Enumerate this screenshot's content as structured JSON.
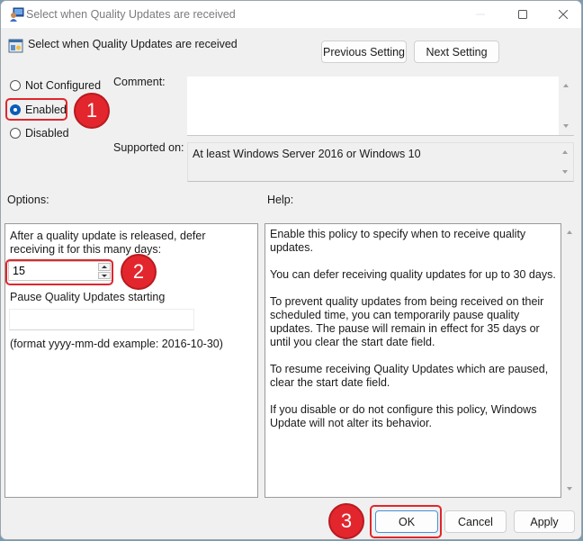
{
  "window": {
    "title": "Select when Quality Updates are received",
    "title_icon": "policy-app-icon",
    "controls": [
      "minimize",
      "maximize",
      "close"
    ]
  },
  "header": {
    "icon": "policy-setting-icon",
    "title": "Select when Quality Updates are received",
    "previous_label": "Previous Setting",
    "next_label": "Next Setting"
  },
  "state": {
    "options": [
      {
        "label": "Not Configured",
        "checked": false
      },
      {
        "label": "Enabled",
        "checked": true
      },
      {
        "label": "Disabled",
        "checked": false
      }
    ]
  },
  "comment": {
    "label": "Comment:",
    "value": ""
  },
  "supported": {
    "label": "Supported on:",
    "value": "At least Windows Server 2016 or Windows 10"
  },
  "options_section": {
    "label": "Options:",
    "defer_description": "After a quality update is released, defer receiving it for this many days:",
    "defer_days_value": "15",
    "pause_label": "Pause Quality Updates starting",
    "pause_value": "",
    "format_hint": "(format yyyy-mm-dd example: 2016-10-30)"
  },
  "help_section": {
    "label": "Help:",
    "paragraphs": [
      "Enable this policy to specify when to receive quality updates.",
      "You can defer receiving quality updates for up to 30 days.",
      "To prevent quality updates from being received on their scheduled time, you can temporarily pause quality updates. The pause will remain in effect for 35 days or until you clear the start date field.",
      "To resume receiving Quality Updates which are paused, clear the start date field.",
      "If you disable or do not configure this policy, Windows Update will not alter its behavior."
    ]
  },
  "footer": {
    "ok_label": "OK",
    "cancel_label": "Cancel",
    "apply_label": "Apply"
  },
  "annotations": [
    {
      "number": "1",
      "target": "Enabled"
    },
    {
      "number": "2",
      "target": "defer-days-spinner"
    },
    {
      "number": "3",
      "target": "OK"
    }
  ],
  "colors": {
    "annotation_red": "#e3262d",
    "selected_radio": "#0a5cb8",
    "focus_blue": "#4a8fd8"
  }
}
